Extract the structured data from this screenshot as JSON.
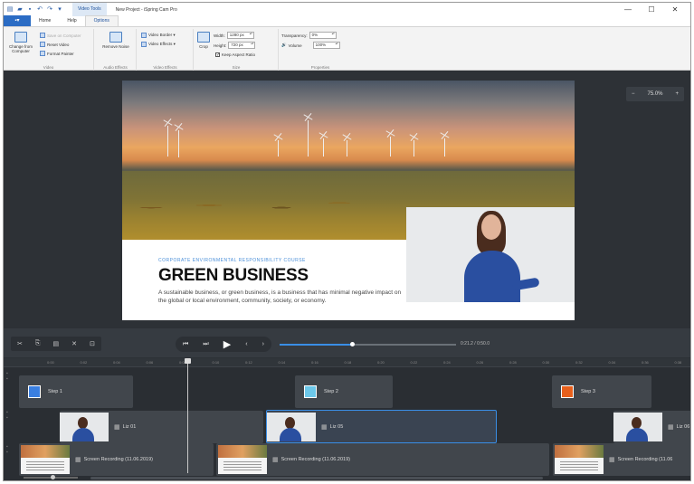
{
  "titlebar": {
    "context_tab": "Video Tools",
    "title": "New Project - iSpring Cam Pro",
    "qat_icons": [
      "app-menu-icon",
      "open-icon",
      "save-icon",
      "undo-icon",
      "redo-icon",
      "customize-icon"
    ],
    "controls": [
      "—",
      "☐",
      "✕"
    ]
  },
  "ribbon_tabs": {
    "file_label": "▪▾",
    "tabs": [
      "Home",
      "Help",
      "Options"
    ],
    "active": "Options"
  },
  "ribbon": {
    "video_group": {
      "label": "Video",
      "change_from_computer": "Change from Computer",
      "save_on_computer": "Save on Computer",
      "reset_video": "Reset Video",
      "format_painter": "Format Painter"
    },
    "audio_group": {
      "label": "Audio Effects",
      "remove_noise": "Remove Noise"
    },
    "effects_group": {
      "label": "Video Effects",
      "video_border": "Video Border ▾",
      "video_effects": "Video Effects ▾"
    },
    "size_group": {
      "label": "Size",
      "crop": "Crop",
      "width_label": "Width:",
      "width_value": "1280 px",
      "height_label": "Height:",
      "height_value": "720 px",
      "keep_aspect": "Keep Aspect Ratio",
      "keep_aspect_checked": "✓"
    },
    "properties_group": {
      "label": "Properties",
      "transparency_label": "Transparency:",
      "transparency_value": "0%",
      "volume_label": "Volume",
      "volume_value": "100%"
    }
  },
  "canvas": {
    "zoom": {
      "minus": "−",
      "value": "75.0%",
      "plus": "+"
    },
    "slide": {
      "kicker": "CORPORATE ENVIRONMENTAL RESPONSIBILITY COURSE",
      "headline": "GREEN BUSINESS",
      "body": "A sustainable business, or green business, is a business that has minimal negative impact on the global or local environment, community, society, or economy."
    }
  },
  "player": {
    "tools": [
      "✂",
      "⎘",
      "▤",
      "✕",
      "⊡"
    ],
    "transport": [
      "⏮",
      "⏭",
      "▶",
      "‹",
      "›"
    ],
    "progress": 0.41,
    "timecode": "0:21.2 / 0:50.0"
  },
  "timeline": {
    "ticks": [
      "0:00",
      "0:02",
      "0:04",
      "0:06",
      "0:08",
      "0:10",
      "0:12",
      "0:14",
      "0:16",
      "0:18",
      "0:20",
      "0:22",
      "0:24",
      "0:26",
      "0:28",
      "0:30",
      "0:32",
      "0:34",
      "0:36",
      "0:38",
      "0:40"
    ],
    "steps": [
      {
        "label": "Step 1",
        "color": "#3a7fe0"
      },
      {
        "label": "Step 2",
        "color": "#6cc8ea"
      },
      {
        "label": "Step 3",
        "color": "#e8601c"
      }
    ],
    "webcam_clips": [
      "Liz 01",
      "Liz 05",
      "Liz 06"
    ],
    "recordings": [
      "Screen Recording (11.06.2019)",
      "Screen Recording (11.06.2019)",
      "Screen Recording (11.06"
    ]
  }
}
